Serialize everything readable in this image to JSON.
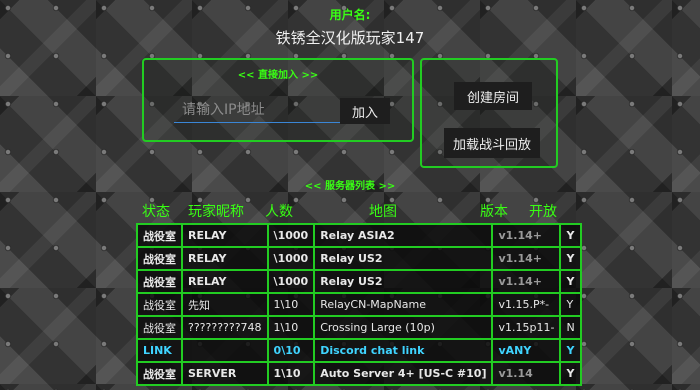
{
  "header": {
    "username_label": "用户名:",
    "username_value": "铁锈全汉化版玩家147"
  },
  "join": {
    "title": "<< 直接加入 >>",
    "ip_placeholder": "请输入IP地址",
    "join_label": "加入"
  },
  "host": {
    "create_room_label": "创建房间",
    "load_replay_label": "加载战斗回放"
  },
  "server_list": {
    "title": "<< 服务器列表 >>",
    "columns": [
      "状态",
      "玩家昵称",
      "人数",
      "地图",
      "版本",
      "开放"
    ],
    "rows": [
      {
        "status": "战役室",
        "name": "RELAY",
        "players": "\\1000",
        "map": "Relay ASIA2",
        "version": "v1.14+",
        "open": "Y"
      },
      {
        "status": "战役室",
        "name": "RELAY",
        "players": "\\1000",
        "map": "Relay US2",
        "version": "v1.14+",
        "open": "Y"
      },
      {
        "status": "战役室",
        "name": "RELAY",
        "players": "\\1000",
        "map": "Relay US2",
        "version": "v1.14+",
        "open": "Y"
      },
      {
        "status": "战役室",
        "name": "先知",
        "players": "1\\10",
        "map": "RelayCN-MapName",
        "version": "v1.15.P*-",
        "open": "Y"
      },
      {
        "status": "战役室",
        "name": "?????????748",
        "players": "1\\10",
        "map": "Crossing Large (10p)",
        "version": "v1.15p11-",
        "open": "N"
      },
      {
        "status": "LINK",
        "name": "",
        "players": "0\\10",
        "map": "Discord chat link",
        "version": "vANY",
        "open": "Y"
      },
      {
        "status": "战役室",
        "name": "SERVER",
        "players": "1\\10",
        "map": "Auto Server 4+ [US-C #10]",
        "version": "v1.14",
        "open": "Y"
      }
    ]
  },
  "colors": {
    "accent_green": "#39ff14",
    "border_green": "#22cc22",
    "link_cyan": "#3fd4ff"
  }
}
